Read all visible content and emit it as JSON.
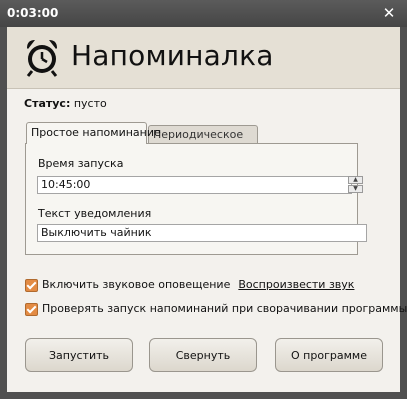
{
  "window": {
    "title": "0:03:00",
    "close_glyph": "✕"
  },
  "header": {
    "title": "Напоминалка",
    "icon": "alarm-clock-icon"
  },
  "status": {
    "label": "Статус:",
    "value": "пусто"
  },
  "tabs": [
    {
      "label": "Простое напоминание",
      "active": true
    },
    {
      "label": "Периодическое",
      "active": false
    }
  ],
  "form": {
    "time_label": "Время запуска",
    "time_value": "10:45:00",
    "text_label": "Текст уведомления",
    "text_value": "Выключить чайник"
  },
  "options": {
    "sound_label": "Включить звуковое оповещение",
    "sound_checked": true,
    "play_link": "Воспроизвести звук",
    "check_label": "Проверять запуск напоминаний при сворачивании программы",
    "check_checked": true
  },
  "buttons": {
    "start": "Запустить",
    "minimize": "Свернуть",
    "about": "О программе"
  },
  "colors": {
    "accent": "#e38b43",
    "header_bg": "#e5e0d5",
    "titlebar": "#4f4f4f"
  }
}
